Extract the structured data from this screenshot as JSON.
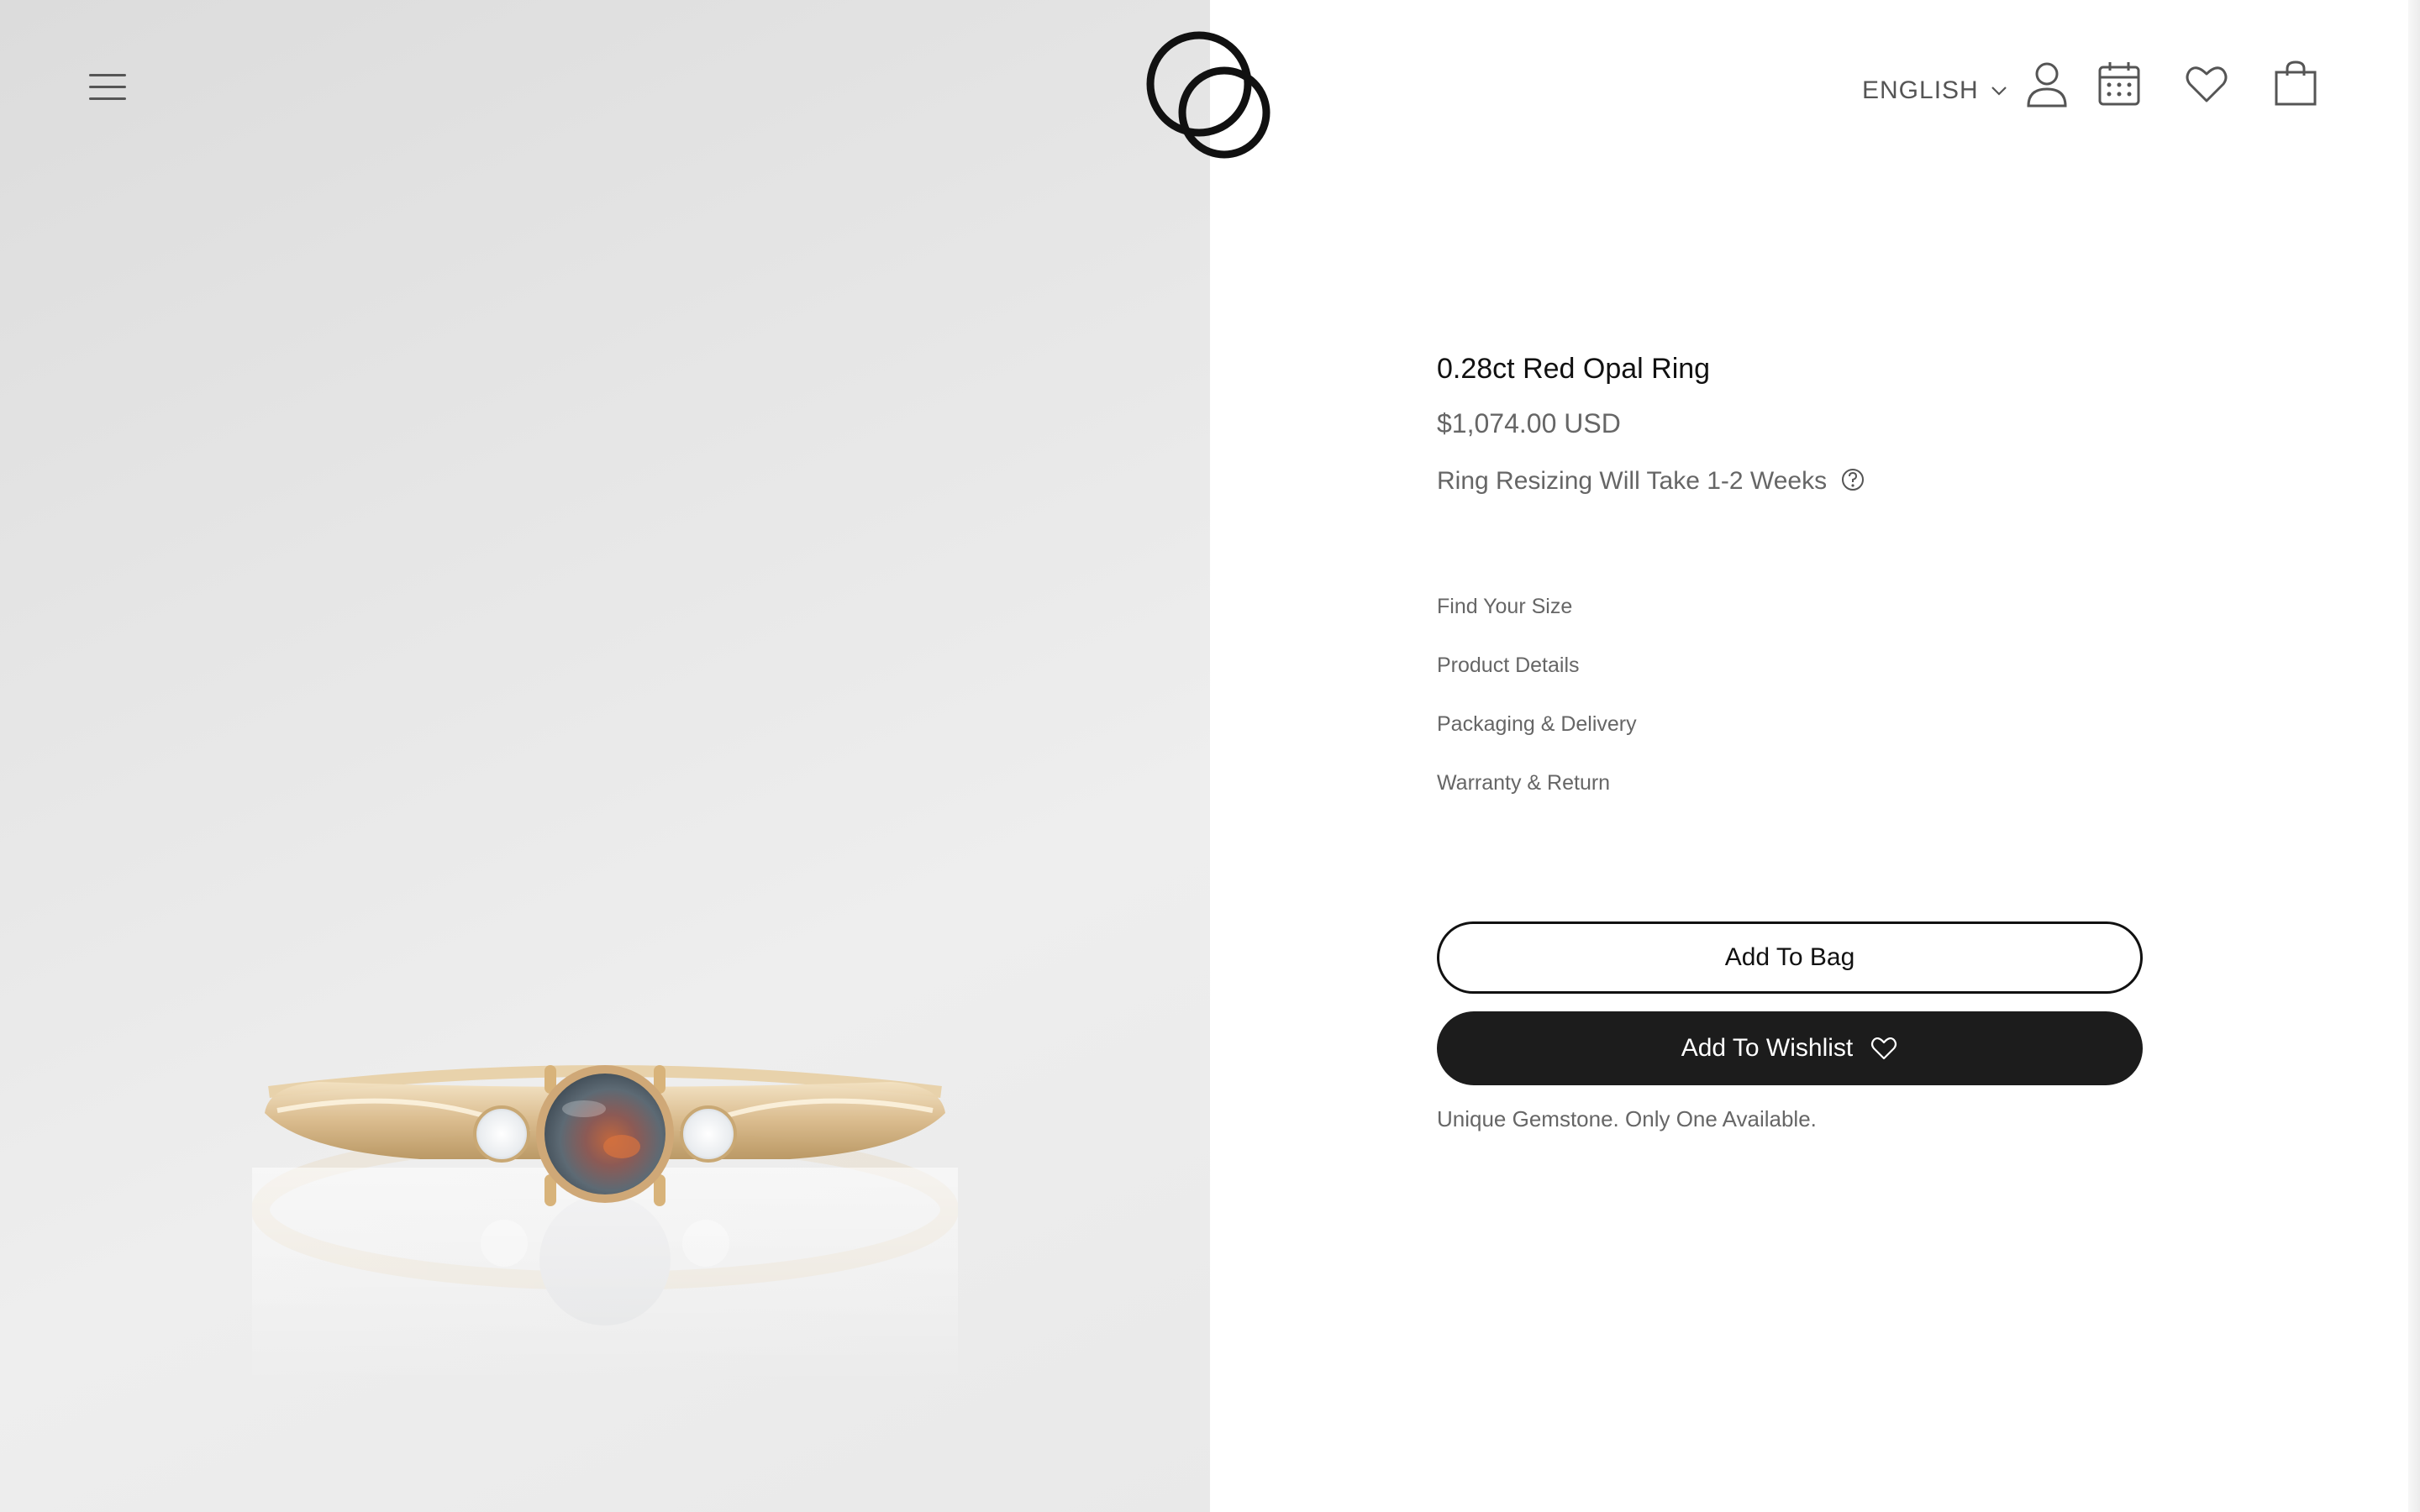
{
  "header": {
    "menu_icon": "hamburger-menu-icon",
    "logo": "brand-logo-interlocking-circles",
    "language": {
      "selected": "ENGLISH",
      "icon": "chevron-down-icon"
    },
    "icons": [
      "account-icon",
      "calendar-icon",
      "wishlist-heart-icon",
      "shopping-bag-icon"
    ]
  },
  "product": {
    "title": "0.28ct Red Opal Ring",
    "price": "$1,074.00 USD",
    "resize_note": "Ring Resizing Will Take 1-2 Weeks",
    "help_icon": "question-circle-icon",
    "links": [
      {
        "label": "Find Your Size"
      },
      {
        "label": "Product Details"
      },
      {
        "label": "Packaging & Delivery"
      },
      {
        "label": "Warranty & Return"
      }
    ],
    "add_to_bag": "Add To Bag",
    "add_to_wishlist": "Add To Wishlist",
    "wishlist_icon": "heart-outline-icon",
    "availability": "Unique Gemstone. Only One Available."
  },
  "colors": {
    "primary_text": "#111111",
    "secondary_text": "#666666",
    "button_dark": "#1c1c1c",
    "image_background": "#e6e6e6",
    "metal": "#e2c79a"
  }
}
